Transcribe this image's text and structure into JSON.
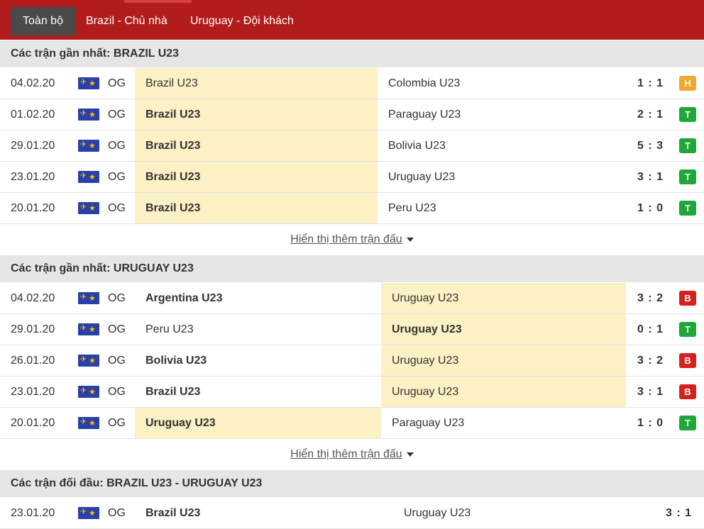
{
  "tabs": [
    {
      "label": "Toàn bộ",
      "active": true
    },
    {
      "label": "Brazil - Chủ nhà",
      "active": false
    },
    {
      "label": "Uruguay - Đội khách",
      "active": false
    }
  ],
  "colors": {
    "win": "#1fa73a",
    "loss": "#d62020",
    "draw": "#f0a830",
    "highlight": "#fcf0c5",
    "header_bar": "#b21c1c"
  },
  "sections": [
    {
      "title": "Các trận gần nhất: BRAZIL U23",
      "more_label": "Hiển thị thêm trận đấu",
      "matches": [
        {
          "date": "04.02.20",
          "league": "OG",
          "home": "Brazil U23",
          "away": "Colombia U23",
          "score": "1 : 1",
          "result": "H"
        },
        {
          "date": "01.02.20",
          "league": "OG",
          "home": "Brazil U23",
          "away": "Paraguay U23",
          "score": "2 : 1",
          "result": "T"
        },
        {
          "date": "29.01.20",
          "league": "OG",
          "home": "Brazil U23",
          "away": "Bolivia U23",
          "score": "5 : 3",
          "result": "T"
        },
        {
          "date": "23.01.20",
          "league": "OG",
          "home": "Brazil U23",
          "away": "Uruguay U23",
          "score": "3 : 1",
          "result": "T"
        },
        {
          "date": "20.01.20",
          "league": "OG",
          "home": "Brazil U23",
          "away": "Peru U23",
          "score": "1 : 0",
          "result": "T"
        }
      ]
    },
    {
      "title": "Các trận gần nhất: URUGUAY U23",
      "more_label": "Hiển thị thêm trận đấu",
      "matches": [
        {
          "date": "04.02.20",
          "league": "OG",
          "home": "Argentina U23",
          "away": "Uruguay U23",
          "score": "3 : 2",
          "result": "B"
        },
        {
          "date": "29.01.20",
          "league": "OG",
          "home": "Peru U23",
          "away": "Uruguay U23",
          "score": "0 : 1",
          "result": "T"
        },
        {
          "date": "26.01.20",
          "league": "OG",
          "home": "Bolivia U23",
          "away": "Uruguay U23",
          "score": "3 : 2",
          "result": "B"
        },
        {
          "date": "23.01.20",
          "league": "OG",
          "home": "Brazil U23",
          "away": "Uruguay U23",
          "score": "3 : 1",
          "result": "B"
        },
        {
          "date": "20.01.20",
          "league": "OG",
          "home": "Uruguay U23",
          "away": "Paraguay U23",
          "score": "1 : 0",
          "result": "T"
        }
      ]
    },
    {
      "title": "Các trận đối đầu: BRAZIL U23 - URUGUAY U23",
      "matches": [
        {
          "date": "23.01.20",
          "league": "OG",
          "home": "Brazil U23",
          "away": "Uruguay U23",
          "score": "3 : 1"
        }
      ]
    }
  ]
}
